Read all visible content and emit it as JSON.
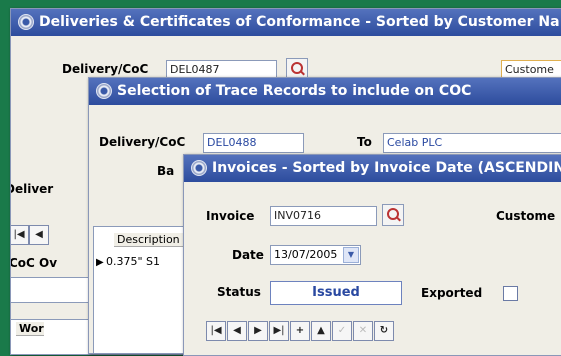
{
  "win1": {
    "title": "Deliveries & Certificates of Conformance - Sorted by Customer Na",
    "delivery_label": "Delivery/CoC",
    "delivery_value": "DEL0487",
    "customer_value": "Custome",
    "left_labels": [
      "Deliver",
      "CoC Ov",
      "Wor"
    ]
  },
  "win2": {
    "title": "Selection of Trace  Records to include on COC",
    "delivery_label": "Delivery/CoC",
    "delivery_value": "DEL0488",
    "to_label": "To",
    "to_value": "Celab PLC",
    "ba_label": "Ba",
    "grid_header": "Description",
    "grid_row": "0.375\" S1"
  },
  "win3": {
    "title": "Invoices - Sorted by Invoice Date (ASCENDIN",
    "invoice_label": "Invoice",
    "invoice_value": "INV0716",
    "customer_label": "Custome",
    "date_label": "Date",
    "date_value": "13/07/2005",
    "status_label": "Status",
    "status_value": "Issued",
    "exported_label": "Exported",
    "nav": {
      "first": "|◀",
      "prev": "◀",
      "next": "▶",
      "last": "▶|",
      "add": "+",
      "up": "▲",
      "check": "✓",
      "delete": "✕",
      "refresh": "↻"
    }
  }
}
